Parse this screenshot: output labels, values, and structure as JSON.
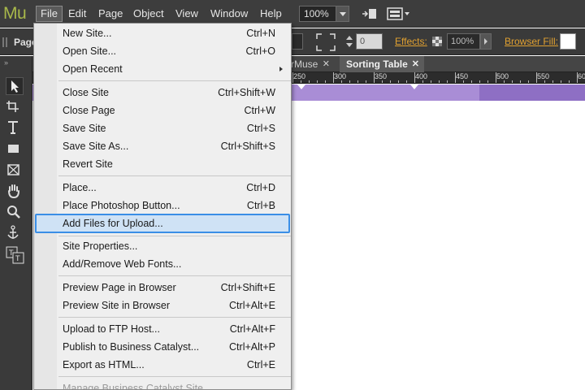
{
  "app": {
    "logo": "Mu"
  },
  "menubar": {
    "items": [
      "File",
      "Edit",
      "Page",
      "Object",
      "View",
      "Window",
      "Help"
    ],
    "zoom": "100%"
  },
  "controlbar": {
    "pages_label": "Page",
    "opacity_value": "0",
    "effects_label": "Effects:",
    "effects_value": "100%",
    "browser_fill_label": "Browser Fill:"
  },
  "tabs": [
    {
      "label": "rMuse",
      "active": false
    },
    {
      "label": "Sorting Table",
      "active": true
    }
  ],
  "ruler": {
    "labels": [
      "250",
      "300",
      "350",
      "400",
      "450",
      "500",
      "550",
      "60"
    ]
  },
  "file_menu": {
    "groups": [
      [
        {
          "label": "New Site...",
          "shortcut": "Ctrl+N"
        },
        {
          "label": "Open Site...",
          "shortcut": "Ctrl+O"
        },
        {
          "label": "Open Recent",
          "shortcut": "",
          "submenu": true
        }
      ],
      [
        {
          "label": "Close Site",
          "shortcut": "Ctrl+Shift+W"
        },
        {
          "label": "Close Page",
          "shortcut": "Ctrl+W"
        },
        {
          "label": "Save Site",
          "shortcut": "Ctrl+S"
        },
        {
          "label": "Save Site As...",
          "shortcut": "Ctrl+Shift+S"
        },
        {
          "label": "Revert Site",
          "shortcut": ""
        }
      ],
      [
        {
          "label": "Place...",
          "shortcut": "Ctrl+D"
        },
        {
          "label": "Place Photoshop Button...",
          "shortcut": "Ctrl+B"
        },
        {
          "label": "Add Files for Upload...",
          "shortcut": "",
          "highlighted": true
        }
      ],
      [
        {
          "label": "Site Properties...",
          "shortcut": ""
        },
        {
          "label": "Add/Remove Web Fonts...",
          "shortcut": ""
        }
      ],
      [
        {
          "label": "Preview Page in Browser",
          "shortcut": "Ctrl+Shift+E"
        },
        {
          "label": "Preview Site in Browser",
          "shortcut": "Ctrl+Alt+E"
        }
      ],
      [
        {
          "label": "Upload to FTP Host...",
          "shortcut": "Ctrl+Alt+F"
        },
        {
          "label": "Publish to Business Catalyst...",
          "shortcut": "Ctrl+Alt+P"
        },
        {
          "label": "Export as HTML...",
          "shortcut": "Ctrl+E"
        }
      ],
      [
        {
          "label": "Manage Business Catalyst Site",
          "shortcut": "",
          "disabled": true
        }
      ]
    ]
  },
  "tools": [
    "selection-tool-icon",
    "crop-tool-icon",
    "text-tool-icon",
    "rectangle-tool-icon",
    "frame-tool-icon",
    "hand-tool-icon",
    "zoom-tool-icon",
    "anchor-tool-icon",
    "fill-stroke-icon"
  ],
  "colors": {
    "menubar": "#3d3d3d",
    "logo": "#a8b84a",
    "accent_label": "#e0a030",
    "highlight": "#cfe2f5",
    "highlight_border": "#3a8ee6",
    "purple": "#a98dd6"
  }
}
